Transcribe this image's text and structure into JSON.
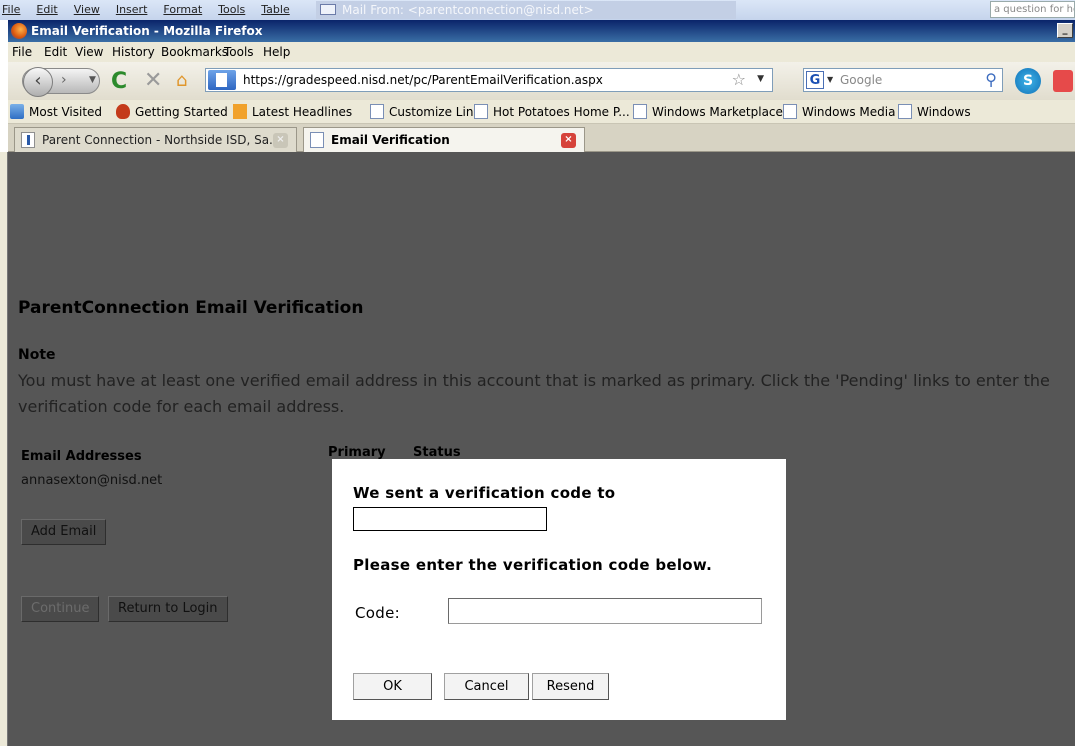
{
  "background_app": {
    "menu": [
      "File",
      "Edit",
      "View",
      "Insert",
      "Format",
      "Tools",
      "Table"
    ],
    "mail_title": "Mail From: <parentconnection@nisd.net>",
    "help_placeholder": "a question for help"
  },
  "window": {
    "title": "Email Verification - Mozilla Firefox"
  },
  "menubar": {
    "items": [
      "File",
      "Edit",
      "View",
      "History",
      "Bookmarks",
      "Tools",
      "Help"
    ]
  },
  "navbar": {
    "url": "https://gradespeed.nisd.net/pc/ParentEmailVerification.aspx",
    "search_placeholder": "Google",
    "search_engine_letter": "G"
  },
  "bookmarks": [
    {
      "label": "Most Visited",
      "icon": "most-visited-icon"
    },
    {
      "label": "Getting Started",
      "icon": "firefox-icon"
    },
    {
      "label": "Latest Headlines",
      "icon": "rss-icon"
    },
    {
      "label": "Customize Links",
      "icon": "page-icon"
    },
    {
      "label": "Hot Potatoes Home P...",
      "icon": "page-icon"
    },
    {
      "label": "Windows Marketplace",
      "icon": "page-icon"
    },
    {
      "label": "Windows Media",
      "icon": "page-icon"
    },
    {
      "label": "Windows",
      "icon": "page-icon"
    }
  ],
  "tabs": [
    {
      "label": "Parent Connection - Northside ISD, Sa...",
      "active": false
    },
    {
      "label": "Email Verification",
      "active": true
    }
  ],
  "page": {
    "heading": "ParentConnection Email Verification",
    "note_title": "Note",
    "note_text": "You must have at least one verified email address in this account that is marked as primary. Click the 'Pending' links to enter the verification code for each email address.",
    "columns": {
      "email": "Email Addresses",
      "primary": "Primary",
      "status": "Status"
    },
    "email_address": "annasexton@nisd.net",
    "add_email_label": "Add Email",
    "continue_label": "Continue",
    "return_label": "Return to Login"
  },
  "modal": {
    "sent_text": "We sent a verification code to",
    "sent_email_value": "",
    "instruction": "Please enter the verification code below.",
    "code_label": "Code:",
    "code_value": "",
    "ok_label": "OK",
    "cancel_label": "Cancel",
    "resend_label": "Resend"
  },
  "colors": {
    "overlay_bg": "#565656",
    "titlebar": "#0a246a",
    "tab_close_active": "#d6433a"
  }
}
